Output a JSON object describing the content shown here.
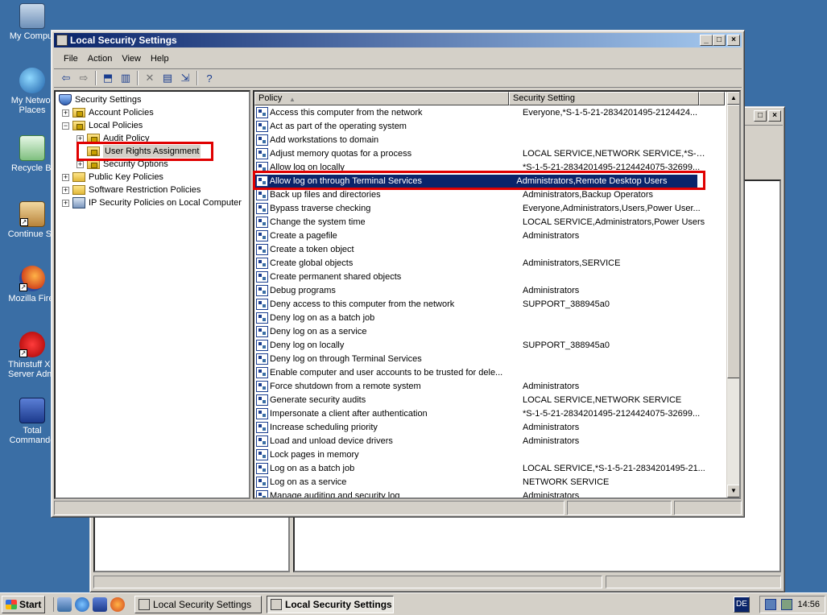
{
  "desktop": {
    "icons": [
      {
        "label": "My Comput",
        "icon": "my-computer-icon"
      },
      {
        "label": "My Networ Places",
        "line1": "My Networ",
        "line2": "Places",
        "icon": "network-places-icon"
      },
      {
        "label": "Recycle Bi",
        "icon": "recycle-bin-icon"
      },
      {
        "label": "Continue Se",
        "icon": "setup-icon"
      },
      {
        "label": "Mozilla Firef",
        "icon": "firefox-icon"
      },
      {
        "line1": "Thinstuff XP",
        "line2": "Server Admi",
        "icon": "thinstuff-icon"
      },
      {
        "line1": "Total",
        "line2": "Commande",
        "icon": "total-commander-icon"
      }
    ]
  },
  "window": {
    "title": "Local Security Settings",
    "menu": [
      "File",
      "Action",
      "View",
      "Help"
    ],
    "tree": [
      {
        "label": "Security Settings",
        "level": 0
      },
      {
        "label": "Account Policies",
        "level": 1,
        "expander": "+"
      },
      {
        "label": "Local Policies",
        "level": 1,
        "expander": "−"
      },
      {
        "label": "Audit Policy",
        "level": 2,
        "expander": "+"
      },
      {
        "label": "User Rights Assignment",
        "level": 2,
        "selected": true
      },
      {
        "label": "Security Options",
        "level": 2,
        "expander": "+"
      },
      {
        "label": "Public Key Policies",
        "level": 1,
        "expander": "+"
      },
      {
        "label": "Software Restriction Policies",
        "level": 1,
        "expander": "+"
      },
      {
        "label": "IP Security Policies on Local Computer",
        "level": 1,
        "expander": "+"
      }
    ],
    "columns": {
      "policy": "Policy",
      "setting": "Security Setting"
    },
    "policies": [
      {
        "policy": "Access this computer from the network",
        "setting": "Everyone,*S-1-5-21-2834201495-2124424..."
      },
      {
        "policy": "Act as part of the operating system",
        "setting": ""
      },
      {
        "policy": "Add workstations to domain",
        "setting": ""
      },
      {
        "policy": "Adjust memory quotas for a process",
        "setting": "LOCAL SERVICE,NETWORK SERVICE,*S-1-5..."
      },
      {
        "policy": "Allow log on locally",
        "setting": "*S-1-5-21-2834201495-2124424075-32699..."
      },
      {
        "policy": "Allow log on through Terminal Services",
        "setting": "Administrators,Remote Desktop Users",
        "selected": true
      },
      {
        "policy": "Back up files and directories",
        "setting": "Administrators,Backup Operators"
      },
      {
        "policy": "Bypass traverse checking",
        "setting": "Everyone,Administrators,Users,Power User..."
      },
      {
        "policy": "Change the system time",
        "setting": "LOCAL SERVICE,Administrators,Power Users"
      },
      {
        "policy": "Create a pagefile",
        "setting": "Administrators"
      },
      {
        "policy": "Create a token object",
        "setting": ""
      },
      {
        "policy": "Create global objects",
        "setting": "Administrators,SERVICE"
      },
      {
        "policy": "Create permanent shared objects",
        "setting": ""
      },
      {
        "policy": "Debug programs",
        "setting": "Administrators"
      },
      {
        "policy": "Deny access to this computer from the network",
        "setting": "SUPPORT_388945a0"
      },
      {
        "policy": "Deny log on as a batch job",
        "setting": ""
      },
      {
        "policy": "Deny log on as a service",
        "setting": ""
      },
      {
        "policy": "Deny log on locally",
        "setting": "SUPPORT_388945a0"
      },
      {
        "policy": "Deny log on through Terminal Services",
        "setting": ""
      },
      {
        "policy": "Enable computer and user accounts to be trusted for dele...",
        "setting": ""
      },
      {
        "policy": "Force shutdown from a remote system",
        "setting": "Administrators"
      },
      {
        "policy": "Generate security audits",
        "setting": "LOCAL SERVICE,NETWORK SERVICE"
      },
      {
        "policy": "Impersonate a client after authentication",
        "setting": "*S-1-5-21-2834201495-2124424075-32699..."
      },
      {
        "policy": "Increase scheduling priority",
        "setting": "Administrators"
      },
      {
        "policy": "Load and unload device drivers",
        "setting": "Administrators"
      },
      {
        "policy": "Lock pages in memory",
        "setting": ""
      },
      {
        "policy": "Log on as a batch job",
        "setting": "LOCAL SERVICE,*S-1-5-21-2834201495-21..."
      },
      {
        "policy": "Log on as a service",
        "setting": "NETWORK SERVICE"
      },
      {
        "policy": "Manage auditing and security log",
        "setting": "Administrators"
      }
    ]
  },
  "taskbar": {
    "start_label": "Start",
    "tasks": [
      {
        "label": "Local Security Settings",
        "active": false
      },
      {
        "label": "Local Security Settings",
        "active": true
      }
    ],
    "language": "DE",
    "clock": "14:56"
  },
  "colors": {
    "desktop": "#3a6ea5",
    "titlebar_active": "#0a246a",
    "selection": "#0a246a",
    "highlight_box": "#e00000"
  }
}
